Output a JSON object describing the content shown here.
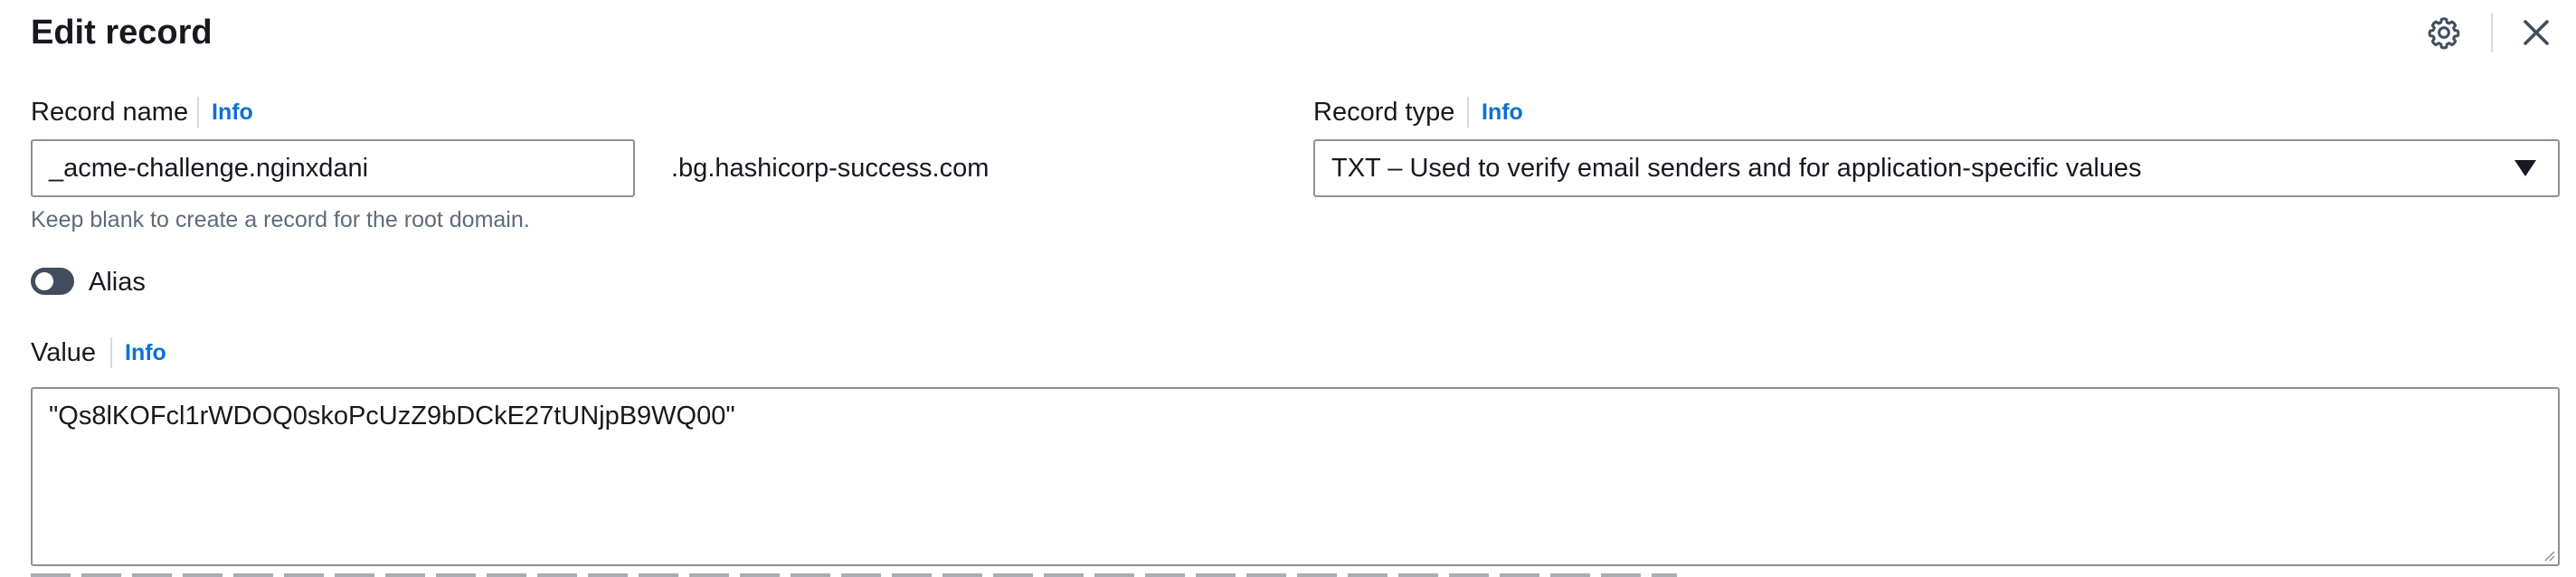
{
  "header": {
    "title": "Edit record",
    "settings_icon": "gear-icon",
    "close_icon": "close-icon"
  },
  "record_name": {
    "label": "Record name",
    "info": "Info",
    "value": "_acme-challenge.nginxdani",
    "suffix": ".bg.hashicorp-success.com",
    "hint": "Keep blank to create a record for the root domain."
  },
  "record_type": {
    "label": "Record type",
    "info": "Info",
    "selected": "TXT – Used to verify email senders and for application-specific values"
  },
  "alias": {
    "label": "Alias",
    "enabled": false
  },
  "value_field": {
    "label": "Value",
    "info": "Info",
    "value": "\"Qs8lKOFcl1rWDOQ0skoPcUzZ9bDCkE27tUNjpB9WQ00\""
  },
  "colors": {
    "text": "#16191f",
    "link": "#0972d3",
    "border": "#8d9096",
    "hint": "#5f6b7a",
    "toggle_off": "#414d5c"
  }
}
